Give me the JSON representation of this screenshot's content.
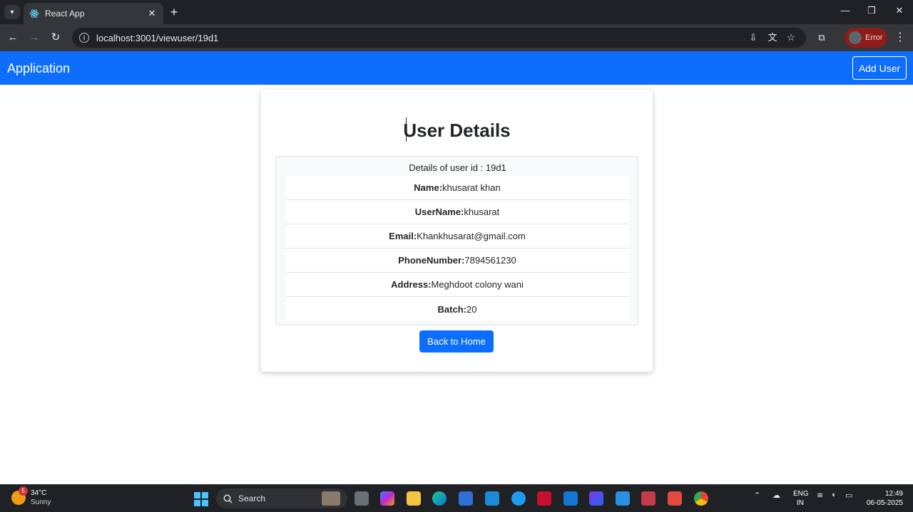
{
  "browser": {
    "tab_title": "React App",
    "url": "localhost:3001/viewuser/19d1",
    "profile_label": "Error"
  },
  "app": {
    "brand": "Application",
    "add_user_label": "Add User"
  },
  "page": {
    "heading": "User Details",
    "subheading": "Details of user id : 19d1",
    "fields": [
      {
        "label": "Name:",
        "value": "khusarat khan"
      },
      {
        "label": "UserName:",
        "value": "khusarat"
      },
      {
        "label": "Email:",
        "value": "Khankhusarat@gmail.com"
      },
      {
        "label": "PhoneNumber:",
        "value": "7894561230"
      },
      {
        "label": "Address:",
        "value": "Meghdoot colony wani"
      },
      {
        "label": "Batch:",
        "value": "20"
      }
    ],
    "back_label": "Back to Home"
  },
  "taskbar": {
    "weather_temp": "34°C",
    "weather_desc": "Sunny",
    "weather_badge": "5",
    "search_label": "Search",
    "lang_line1": "ENG",
    "lang_line2": "IN",
    "time": "12:49",
    "date": "06-05-2025"
  },
  "colors": {
    "navbar": "#0d6efd",
    "primary_button": "#0d6efd",
    "profile_error": "#8c1d18"
  }
}
